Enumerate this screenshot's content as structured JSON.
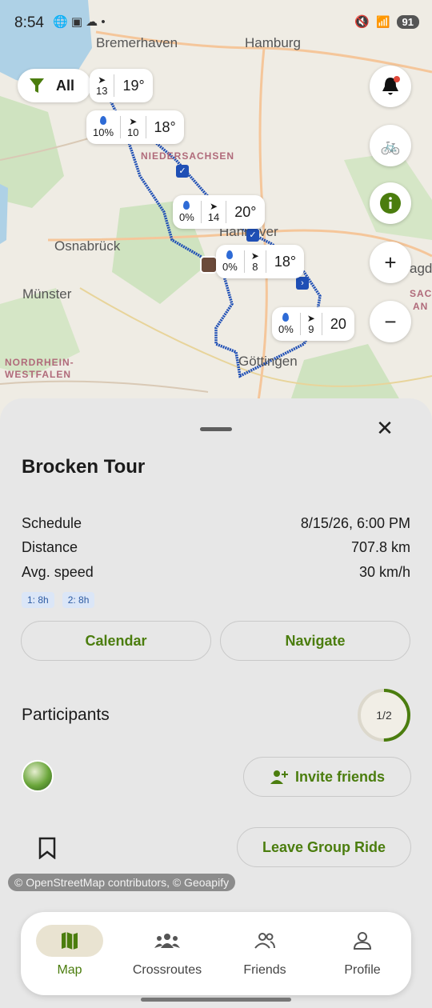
{
  "status_bar": {
    "time": "8:54",
    "battery": "91"
  },
  "map": {
    "cities": [
      "Bremerhaven",
      "Hamburg",
      "Osnabrück",
      "Münster",
      "Hannover",
      "Göttingen"
    ],
    "regions": [
      "NIEDERSACHSEN",
      "NORDRHEIN-",
      "WESTFALEN",
      "SAC",
      "AN",
      "agd"
    ],
    "filter_label": "All",
    "weather_chips": [
      {
        "wind": "13",
        "temp": "19°"
      },
      {
        "rain": "10%",
        "wind": "10",
        "temp": "18°"
      },
      {
        "rain": "0%",
        "wind": "14",
        "temp": "20°"
      },
      {
        "rain": "0%",
        "wind": "8",
        "temp": "18°"
      },
      {
        "rain": "0%",
        "wind": "9",
        "temp": "20"
      }
    ],
    "accent_color": "#4b7d0e",
    "route_color": "#1f4fb5"
  },
  "tour": {
    "title": "Brocken Tour",
    "rows": [
      {
        "label": "Schedule",
        "value": "8/15/26, 6:00 PM"
      },
      {
        "label": "Distance",
        "value": "707.8 km"
      },
      {
        "label": "Avg. speed",
        "value": "30 km/h"
      }
    ],
    "tags": [
      "1: 8h",
      "2: 8h"
    ],
    "calendar_label": "Calendar",
    "navigate_label": "Navigate",
    "participants_label": "Participants",
    "participants_count": "1/2",
    "participants_fraction": 0.5,
    "invite_label": "Invite friends",
    "leave_label": "Leave Group Ride",
    "attribution": "© OpenStreetMap contributors, © Geoapify"
  },
  "nav": [
    {
      "label": "Map",
      "icon": "map-icon",
      "active": true
    },
    {
      "label": "Crossroutes",
      "icon": "groups-icon",
      "active": false
    },
    {
      "label": "Friends",
      "icon": "friends-icon",
      "active": false
    },
    {
      "label": "Profile",
      "icon": "profile-icon",
      "active": false
    }
  ]
}
